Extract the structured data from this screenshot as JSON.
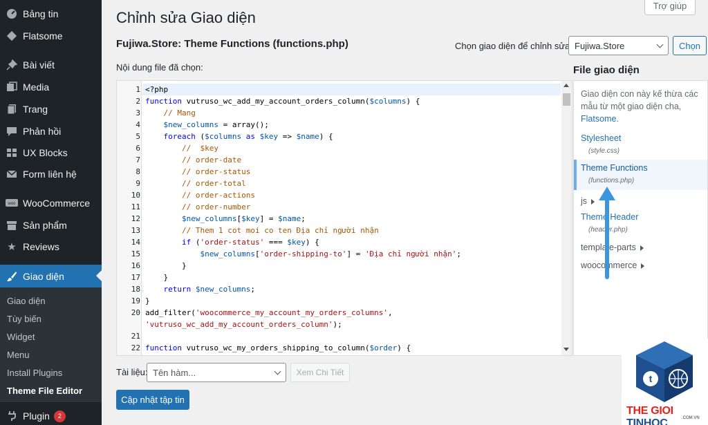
{
  "sidebar": {
    "items": [
      {
        "label": "Bảng tin",
        "icon": "dashboard-icon"
      },
      {
        "label": "Flatsome",
        "icon": "flatsome-icon"
      },
      {
        "label": "Bài viết",
        "icon": "pin-icon"
      },
      {
        "label": "Media",
        "icon": "media-icon"
      },
      {
        "label": "Trang",
        "icon": "page-icon"
      },
      {
        "label": "Phản hồi",
        "icon": "comment-icon"
      },
      {
        "label": "UX Blocks",
        "icon": "grid-icon"
      },
      {
        "label": "Form liên hệ",
        "icon": "mail-icon"
      },
      {
        "label": "WooCommerce",
        "icon": "woo-icon"
      },
      {
        "label": "Sản phẩm",
        "icon": "archive-icon"
      },
      {
        "label": "Reviews",
        "icon": "star-icon"
      },
      {
        "label": "Giao diện",
        "icon": "brush-icon"
      }
    ],
    "submenu": [
      "Giao diện",
      "Tùy biến",
      "Widget",
      "Menu",
      "Install Plugins",
      "Theme File Editor"
    ],
    "plugin": {
      "label": "Plugin",
      "badge": "2",
      "icon": "plugin-icon"
    }
  },
  "header": {
    "help": "Trợ giúp",
    "page_title": "Chỉnh sửa Giao diện",
    "file_title": "Fujiwa.Store: Theme Functions (functions.php)",
    "choose_label": "Chọn giao diện để chỉnh sửa:",
    "theme_selected": "Fujiwa.Store",
    "choose_button": "Chọn",
    "content_label": "Nội dung file đã chọn:"
  },
  "editor": {
    "line_numbers": [
      "1",
      "2",
      "3",
      "4",
      "5",
      "6",
      "7",
      "8",
      "9",
      "10",
      "11",
      "12",
      "13",
      "14",
      "15",
      "16",
      "17",
      "18",
      "19",
      "20",
      "",
      "21",
      "22",
      "23"
    ]
  },
  "files": {
    "heading": "File giao diện",
    "note": "Giao diện con này kế thừa các mẫu từ một giao diện cha,",
    "note_link": "Flatsome.",
    "stylesheet": "Stylesheet",
    "stylesheet_file": "(style.css)",
    "functions": "Theme Functions",
    "functions_file": "(functions.php)",
    "js": "js",
    "header": "Theme Header",
    "header_file": "(header.php)",
    "template_parts": "template-parts",
    "woocommerce": "woocommerce"
  },
  "footer": {
    "docs_label": "Tài liệu:",
    "docs_placeholder": "Tên hàm...",
    "lookup_button": "Xem Chi Tiết",
    "update_button": "Cập nhật tập tin"
  },
  "watermark": {
    "brand_a": "THE GIOI",
    "brand_b": "TINHOC",
    "domain": ".COM.VN"
  },
  "colors": {
    "accent": "#2271b1",
    "sidebar": "#1d2327",
    "arrow": "#3a96dd",
    "brand_red": "#e2231a"
  }
}
